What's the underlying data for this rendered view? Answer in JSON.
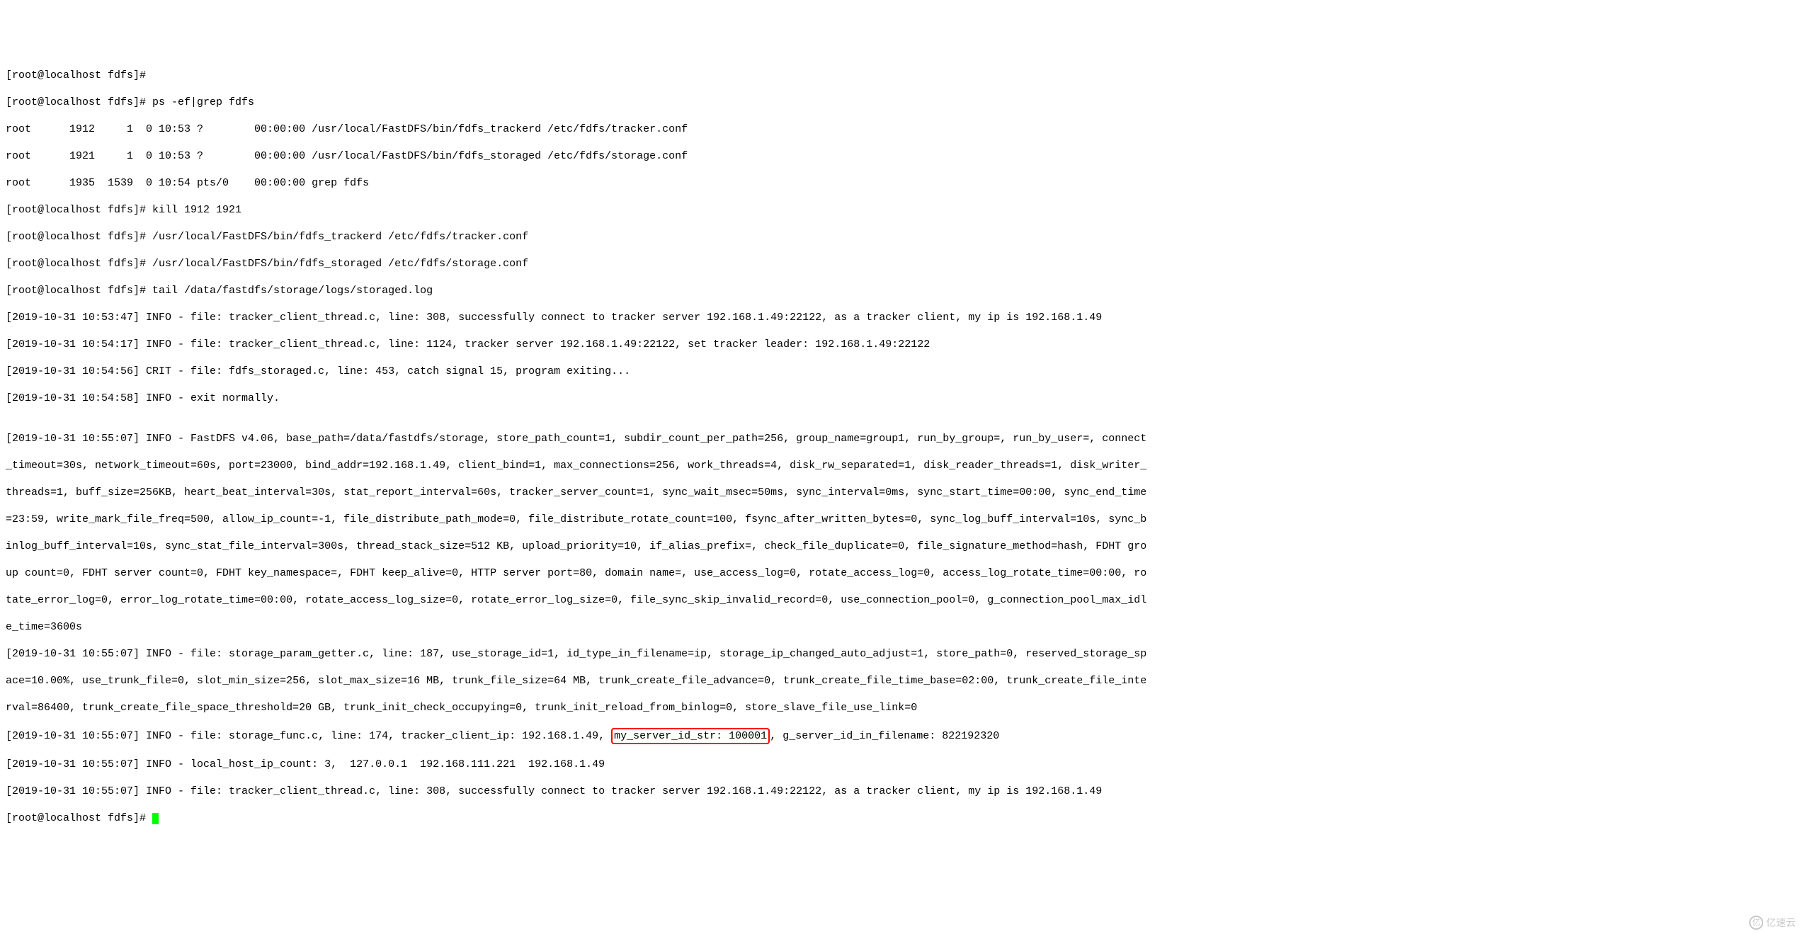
{
  "lines": {
    "l0": "[root@localhost fdfs]#",
    "l1": "[root@localhost fdfs]# ps -ef|grep fdfs",
    "l2": "root      1912     1  0 10:53 ?        00:00:00 /usr/local/FastDFS/bin/fdfs_trackerd /etc/fdfs/tracker.conf",
    "l3": "root      1921     1  0 10:53 ?        00:00:00 /usr/local/FastDFS/bin/fdfs_storaged /etc/fdfs/storage.conf",
    "l4": "root      1935  1539  0 10:54 pts/0    00:00:00 grep fdfs",
    "l5": "[root@localhost fdfs]# kill 1912 1921",
    "l6": "[root@localhost fdfs]# /usr/local/FastDFS/bin/fdfs_trackerd /etc/fdfs/tracker.conf",
    "l7": "[root@localhost fdfs]# /usr/local/FastDFS/bin/fdfs_storaged /etc/fdfs/storage.conf",
    "l8": "[root@localhost fdfs]# tail /data/fastdfs/storage/logs/storaged.log",
    "l9": "[2019-10-31 10:53:47] INFO - file: tracker_client_thread.c, line: 308, successfully connect to tracker server 192.168.1.49:22122, as a tracker client, my ip is 192.168.1.49",
    "l10": "[2019-10-31 10:54:17] INFO - file: tracker_client_thread.c, line: 1124, tracker server 192.168.1.49:22122, set tracker leader: 192.168.1.49:22122",
    "l11": "[2019-10-31 10:54:56] CRIT - file: fdfs_storaged.c, line: 453, catch signal 15, program exiting...",
    "l12": "[2019-10-31 10:54:58] INFO - exit normally.",
    "l13": "",
    "l14a": "[2019-10-31 10:55:07] INFO - FastDFS v4.06, base_path=/data/fastdfs/storage, store_path_count=1, subdir_count_per_path=256, group_name=group1, run_by_group=, run_by_user=, connect",
    "l14b": "_timeout=30s, network_timeout=60s, port=23000, bind_addr=192.168.1.49, client_bind=1, max_connections=256, work_threads=4, disk_rw_separated=1, disk_reader_threads=1, disk_writer_",
    "l14c": "threads=1, buff_size=256KB, heart_beat_interval=30s, stat_report_interval=60s, tracker_server_count=1, sync_wait_msec=50ms, sync_interval=0ms, sync_start_time=00:00, sync_end_time",
    "l14d": "=23:59, write_mark_file_freq=500, allow_ip_count=-1, file_distribute_path_mode=0, file_distribute_rotate_count=100, fsync_after_written_bytes=0, sync_log_buff_interval=10s, sync_b",
    "l14e": "inlog_buff_interval=10s, sync_stat_file_interval=300s, thread_stack_size=512 KB, upload_priority=10, if_alias_prefix=, check_file_duplicate=0, file_signature_method=hash, FDHT gro",
    "l14f": "up count=0, FDHT server count=0, FDHT key_namespace=, FDHT keep_alive=0, HTTP server port=80, domain name=, use_access_log=0, rotate_access_log=0, access_log_rotate_time=00:00, ro",
    "l14g": "tate_error_log=0, error_log_rotate_time=00:00, rotate_access_log_size=0, rotate_error_log_size=0, file_sync_skip_invalid_record=0, use_connection_pool=0, g_connection_pool_max_idl",
    "l14h": "e_time=3600s",
    "l15a": "[2019-10-31 10:55:07] INFO - file: storage_param_getter.c, line: 187, use_storage_id=1, id_type_in_filename=ip, storage_ip_changed_auto_adjust=1, store_path=0, reserved_storage_sp",
    "l15b": "ace=10.00%, use_trunk_file=0, slot_min_size=256, slot_max_size=16 MB, trunk_file_size=64 MB, trunk_create_file_advance=0, trunk_create_file_time_base=02:00, trunk_create_file_inte",
    "l15c": "rval=86400, trunk_create_file_space_threshold=20 GB, trunk_init_check_occupying=0, trunk_init_reload_from_binlog=0, store_slave_file_use_link=0",
    "l16_before": "[2019-10-31 10:55:07] INFO - file: storage_func.c, line: 174, tracker_client_ip: 192.168.1.49, ",
    "l16_highlight": "my_server_id_str: 100001",
    "l16_after": ", g_server_id_in_filename: 822192320",
    "l17": "[2019-10-31 10:55:07] INFO - local_host_ip_count: 3,  127.0.0.1  192.168.111.221  192.168.1.49",
    "l18": "[2019-10-31 10:55:07] INFO - file: tracker_client_thread.c, line: 308, successfully connect to tracker server 192.168.1.49:22122, as a tracker client, my ip is 192.168.1.49",
    "l19": "[root@localhost fdfs]# "
  },
  "watermark": "亿速云"
}
